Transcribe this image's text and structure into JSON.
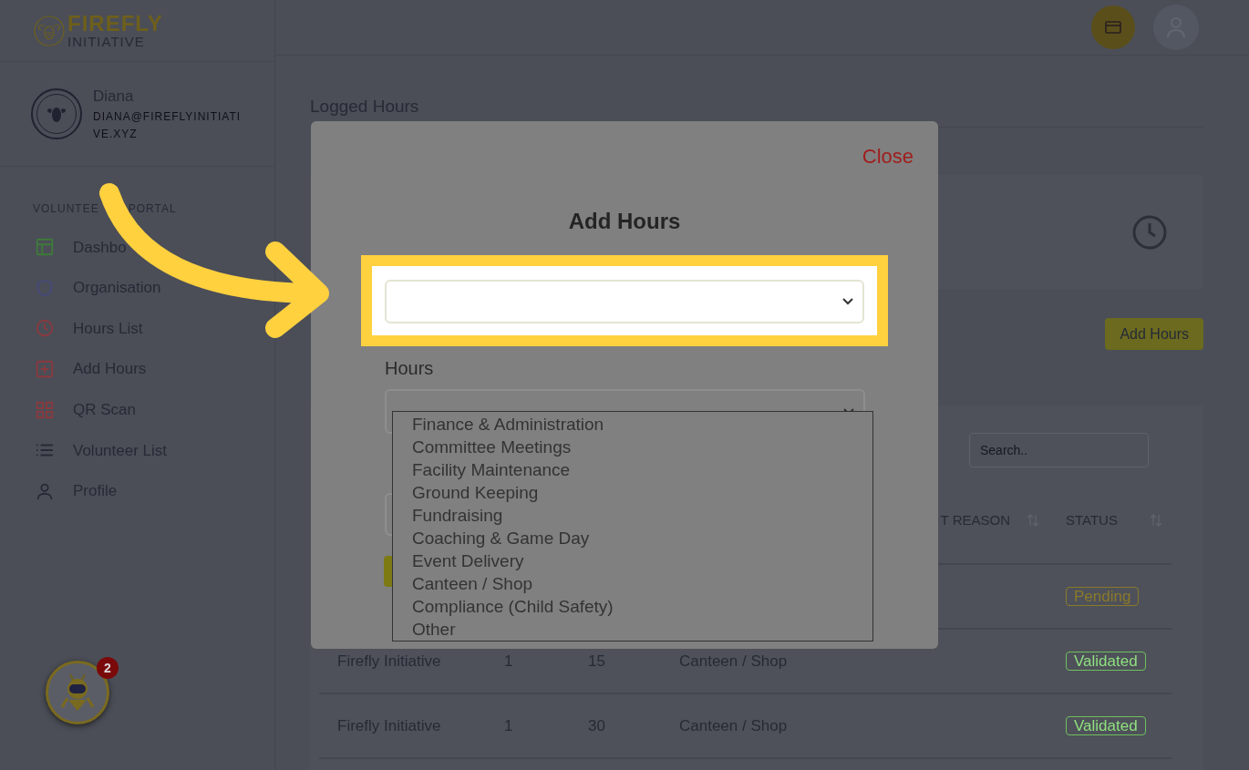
{
  "logo": {
    "line_1": "FIREFLY",
    "line_2": "INITIATIVE"
  },
  "user": {
    "name": "Diana",
    "email": "DIANA@FIREFLYINITIATIVE.XYZ"
  },
  "sidebar": {
    "section_parts": [
      "VOLUNTEE",
      "PORTAL"
    ],
    "items": [
      {
        "label": "Dashbo"
      },
      {
        "label": "Organisation"
      },
      {
        "label": "Hours List"
      },
      {
        "label": "Add Hours"
      },
      {
        "label": "QR Scan"
      },
      {
        "label": "Volunteer List"
      },
      {
        "label": "Profile"
      }
    ]
  },
  "chat_badge": "2",
  "page": {
    "title": "Logged Hours",
    "add_button": "Add Hours",
    "search": {
      "placeholder": "Search.."
    },
    "table": {
      "columns": [
        {
          "label": "T REASON"
        },
        {
          "label": "STATUS"
        }
      ],
      "rows": [
        {
          "status": "Pending",
          "kind": "pending"
        },
        {
          "cells": [
            "Firefly Initiative",
            "1",
            "15",
            "Canteen / Shop"
          ],
          "status": "Validated",
          "kind": "validated"
        },
        {
          "cells": [
            "Firefly Initiative",
            "1",
            "30",
            "Canteen / Shop"
          ],
          "status": "Validated",
          "kind": "validated"
        }
      ]
    }
  },
  "modal": {
    "close": "Close",
    "title": "Add Hours",
    "hours_label": "Hours",
    "activity_options": [
      "Finance & Administration",
      "Committee Meetings",
      "Facility Maintenance",
      "Ground Keeping",
      "Fundraising",
      "Coaching & Game Day",
      "Event Delivery",
      "Canteen / Shop",
      "Compliance (Child Safety)",
      "Other"
    ]
  }
}
